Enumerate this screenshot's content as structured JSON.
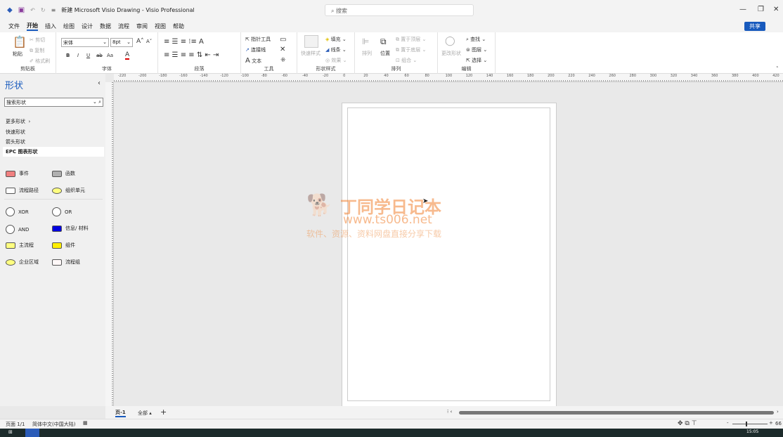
{
  "titlebar": {
    "title": "新建 Microsoft Visio Drawing  -  Visio Professional",
    "search_placeholder": "搜索"
  },
  "menu": {
    "tabs": [
      "文件",
      "开始",
      "插入",
      "绘图",
      "设计",
      "数据",
      "流程",
      "审阅",
      "视图",
      "帮助"
    ],
    "active": "开始",
    "share": "共享"
  },
  "ribbon": {
    "clipboard": {
      "paste": "粘贴",
      "cut": "剪切",
      "copy": "复制",
      "format_painter": "格式刷",
      "label": "剪贴板"
    },
    "font": {
      "font_name": "宋体",
      "font_size": "8pt",
      "bold": "B",
      "italic": "I",
      "underline": "U",
      "strike": "ab",
      "case": "Aa",
      "label": "字体"
    },
    "paragraph": {
      "label": "段落"
    },
    "tools": {
      "pointer": "指针工具",
      "connector": "连接线",
      "text": "文本",
      "label": "工具"
    },
    "shape_styles": {
      "quick_styles": "快速样式",
      "fill": "填充",
      "line": "线条",
      "effects": "效果",
      "label": "形状样式"
    },
    "arrange": {
      "arrange": "排列",
      "position": "位置",
      "bring_front": "置于顶层",
      "send_back": "置于底层",
      "group": "组合",
      "label": "排列"
    },
    "editing": {
      "change_shape": "更改形状",
      "find": "查找",
      "layers": "图层",
      "select": "选择",
      "label": "编辑"
    }
  },
  "ruler": {
    "labels": [
      "-220",
      "-200",
      "-180",
      "-160",
      "-140",
      "-120",
      "-100",
      "-80",
      "-60",
      "-40",
      "-20",
      "0",
      "20",
      "40",
      "60",
      "80",
      "100",
      "120",
      "140",
      "160",
      "180",
      "200",
      "220",
      "240",
      "260",
      "280",
      "300",
      "320",
      "340",
      "360",
      "380",
      "400",
      "420"
    ]
  },
  "shapes_pane": {
    "title": "形状",
    "search_placeholder": "搜索形状",
    "more_shapes": "更多形状",
    "stencils": [
      "快速形状",
      "箭头形状",
      "EPC 图表形状"
    ],
    "items": [
      {
        "label": "事件",
        "color": "#f08080"
      },
      {
        "label": "函数",
        "color": "#b0b0b0"
      },
      {
        "label": "流程路径",
        "color": "#ffffff"
      },
      {
        "label": "组织单元",
        "color": "#ffff80"
      },
      {
        "label": "XOR",
        "color": "#ffffff"
      },
      {
        "label": "OR",
        "color": "#ffffff"
      },
      {
        "label": "AND",
        "color": "#ffffff"
      },
      {
        "label": "信息/ 材料",
        "color": "#0000e0"
      },
      {
        "label": "主流程",
        "color": "#ffff80"
      },
      {
        "label": "组件",
        "color": "#ffee00"
      },
      {
        "label": "企业区域",
        "color": "#ffff80"
      },
      {
        "label": "流程组",
        "color": "#fff8f8"
      }
    ]
  },
  "watermark": {
    "title": "丁同学日记本",
    "url": "www.ts006.net",
    "tagline": "软件、资源、资料网盘直接分享下载"
  },
  "pagetabs": {
    "page": "页-1",
    "all": "全部",
    "add": "+"
  },
  "status": {
    "page": "页面 1/1",
    "language": "简体中文(中国大陆)",
    "zoom": "66"
  },
  "taskbar": {
    "time": "15:05"
  }
}
